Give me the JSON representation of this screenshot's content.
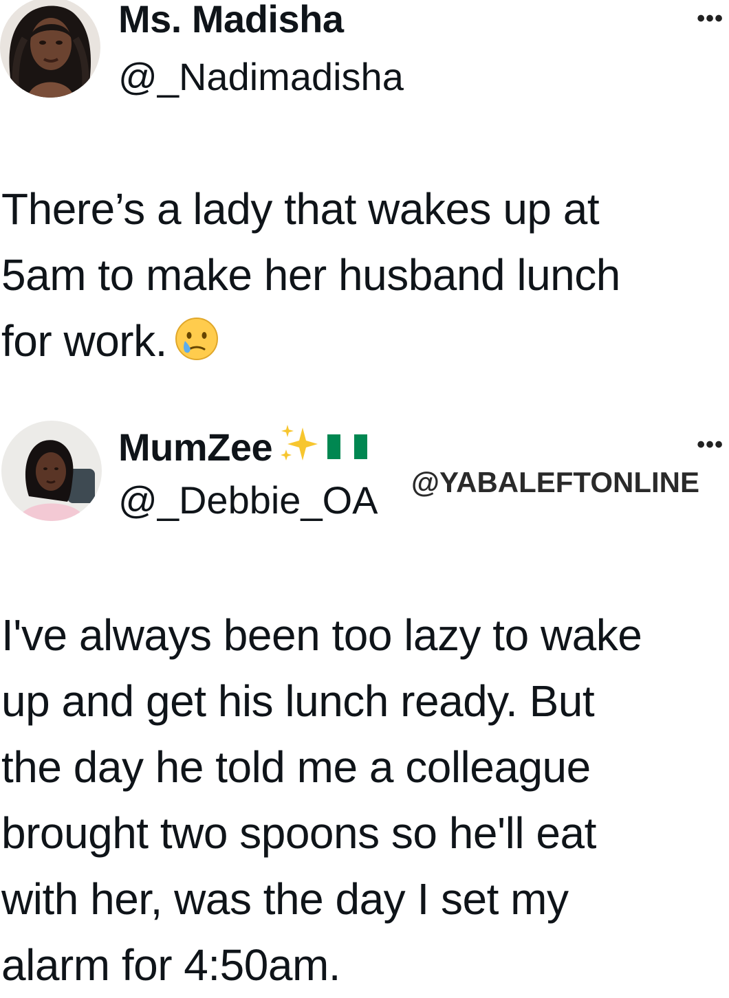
{
  "tweets": [
    {
      "display_name": "Ms. Madisha",
      "handle": "@_Nadimadisha",
      "more_label": "•••",
      "text": "There’s a lady that wakes up at\n5am to make her husband lunch\nfor work.",
      "emoji": "crying-face-icon"
    },
    {
      "display_name": "MumZee",
      "handle": "@_Debbie_OA",
      "more_label": "•••",
      "name_badges": [
        "sparkles-icon",
        "nigeria-flag-icon"
      ],
      "text": "I've always been too lazy to wake\nup and get his lunch ready. But\nthe day he told me a colleague\nbrought two spoons so he'll eat\nwith her, was the day I set my\nalarm for 4:50am."
    }
  ],
  "watermark": "@YABALEFTONLINE",
  "colors": {
    "text": "#0f1419",
    "flag_green": "#008751",
    "sparkle_yellow": "#f7c62f",
    "emoji_yellow": "#ffcc4d",
    "tear_blue": "#5dadec"
  }
}
